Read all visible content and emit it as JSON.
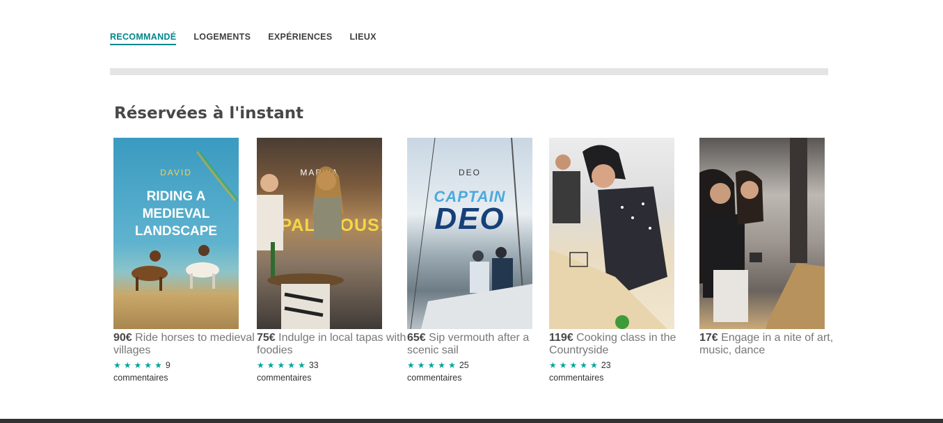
{
  "tabs": [
    {
      "label": "RECOMMANDÉ",
      "active": true
    },
    {
      "label": "LOGEMENTS",
      "active": false
    },
    {
      "label": "EXPÉRIENCES",
      "active": false
    },
    {
      "label": "LIEUX",
      "active": false
    }
  ],
  "section_title": "Réservées à l'instant",
  "colors": {
    "accent": "#00868a",
    "star": "#00a699",
    "divider": "#e4e4e4"
  },
  "cards": [
    {
      "price": "90€",
      "title": "Ride horses to medieval villages",
      "stars": 5,
      "count": "9",
      "reviews_label": "commentaires",
      "host": "DAVID",
      "poster_title": "RIDING A MEDIEVAL LANDSCAPE"
    },
    {
      "price": "75€",
      "title": "Indulge in local tapas with foodies",
      "stars": 5,
      "count": "33",
      "reviews_label": "commentaires",
      "host": "MARWA",
      "poster_title": "TAPALICIOUS!"
    },
    {
      "price": "65€",
      "title": "Sip vermouth after a scenic sail",
      "stars": 5,
      "count": "25",
      "reviews_label": "commentaires",
      "host": "DEO",
      "poster_title_line1": "CAPTAIN",
      "poster_title_line2": "DEO"
    },
    {
      "price": "119€",
      "title": "Cooking class in the Countryside",
      "stars": 5,
      "count": "23",
      "reviews_label": "commentaires"
    },
    {
      "price": "17€",
      "title": "Engage in a nite of art, music, dance"
    }
  ]
}
